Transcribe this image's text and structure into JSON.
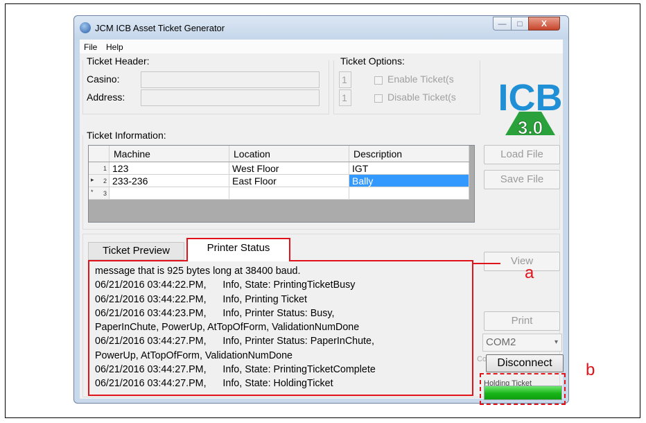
{
  "window": {
    "title": "JCM ICB Asset Ticket Generator",
    "min_glyph": "—",
    "max_glyph": "□",
    "close_glyph": "X"
  },
  "menu": [
    "File",
    "Help"
  ],
  "ticket_header": {
    "title": "Ticket Header:",
    "casino_label": "Casino:",
    "casino_value": "",
    "address_label": "Address:",
    "address_value": ""
  },
  "ticket_options": {
    "title": "Ticket Options:",
    "enable_qty": "1",
    "enable_label": "Enable Ticket(s",
    "disable_qty": "1",
    "disable_label": "Disable Ticket(s"
  },
  "logo": {
    "line1": "ICB",
    "line2": "3.0"
  },
  "ticket_info": {
    "title": "Ticket Information:",
    "columns": [
      "Machine",
      "Location",
      "Description"
    ],
    "rows": [
      {
        "num": "1",
        "marker": "",
        "machine": "123",
        "location": "West Floor",
        "description": "IGT"
      },
      {
        "num": "2",
        "marker": "▸",
        "machine": "233-236",
        "location": "East Floor",
        "description": "Bally"
      },
      {
        "num": "3",
        "marker": "*",
        "machine": "",
        "location": "",
        "description": ""
      }
    ]
  },
  "buttons": {
    "load_file": "Load File",
    "save_file": "Save File",
    "view": "View",
    "print": "Print",
    "disconnect": "Disconnect"
  },
  "tabs": {
    "preview": "Ticket Preview",
    "status": "Printer Status"
  },
  "log": [
    "message that is 925 bytes long at 38400 baud.",
    "06/21/2016 03:44:22.PM,      Info, State: PrintingTicketBusy",
    "06/21/2016 03:44:22.PM,      Info, Printing Ticket",
    "06/21/2016 03:44:23.PM,      Info, Printer Status: Busy,",
    "PaperInChute, PowerUp, AtTopOfForm, ValidationNumDone",
    "06/21/2016 03:44:27.PM,      Info, Printer Status: PaperInChute,",
    "PowerUp, AtTopOfForm, ValidationNumDone",
    "06/21/2016 03:44:27.PM,      Info, State: PrintingTicketComplete",
    "06/21/2016 03:44:27.PM,      Info, State: HoldingTicket"
  ],
  "com_port": {
    "value": "COM2",
    "arrow": "▾"
  },
  "com_clip_label": "Co",
  "status": {
    "label": "Holding Ticket",
    "progress": 1.0
  },
  "callouts": {
    "a": "a",
    "b": "b"
  },
  "colors": {
    "accent_red": "#e0131a",
    "selection_blue": "#3399ff",
    "progress_green": "#18b418"
  }
}
